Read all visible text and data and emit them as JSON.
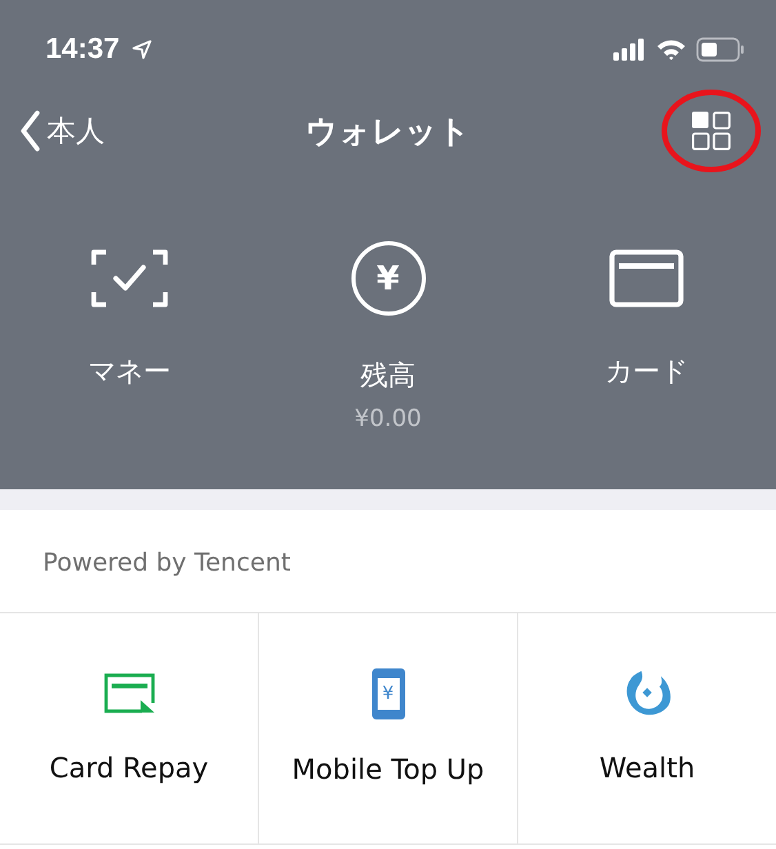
{
  "status_bar": {
    "time": "14:37"
  },
  "nav": {
    "back": "本人",
    "title": "ウォレット",
    "menu_highlighted": true
  },
  "wallet_items": [
    {
      "kind": "money",
      "label": "マネー"
    },
    {
      "kind": "balance",
      "label": "残高",
      "icon_glyph": "¥",
      "amount": "¥0.00"
    },
    {
      "kind": "card",
      "label": "カード"
    }
  ],
  "services": {
    "caption": "Powered by Tencent",
    "items": [
      {
        "kind": "card-repay",
        "label": "Card Repay"
      },
      {
        "kind": "mobile",
        "label": "Mobile Top Up",
        "icon_glyph": "¥"
      },
      {
        "kind": "wealth",
        "label": "Wealth"
      }
    ]
  }
}
